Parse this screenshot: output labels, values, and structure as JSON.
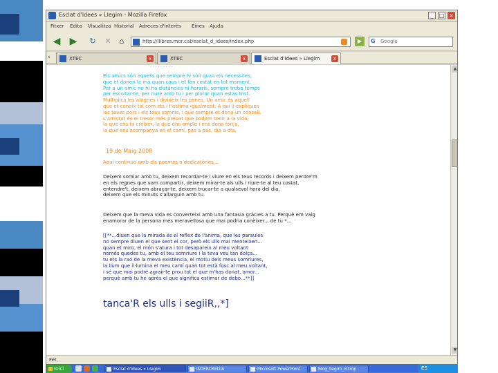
{
  "window": {
    "title": "Esclat d'Idees » Llegim - Mozilla Firefox",
    "buttons": {
      "minimize": "_",
      "maximize": "□",
      "close": "x"
    }
  },
  "menu": [
    "Fitxer",
    "Edita",
    "Visualitza",
    "Historial",
    "Adreces d'interès",
    "Eines",
    "Ajuda"
  ],
  "nav": {
    "url": "http://llibres.mor.cat/esclat_d_idees/index.php",
    "search_engine_glyph": "G",
    "search_placeholder": "Google"
  },
  "tabs": [
    {
      "label": "XTEC",
      "active": false
    },
    {
      "label": "XTEC",
      "active": false
    },
    {
      "label": "Esclat d'Idees » Llegim",
      "active": true
    }
  ],
  "content": {
    "top_fragment": "· · · · · · · · ·",
    "cyan_lines": [
      "Els amics són aquells que sempre hi són quan els necessites,",
      "que et donen la mà quan caus i et fan costat en tot moment.",
      "Per a un amic no hi ha distàncies ni horaris, sempre troba temps",
      "per escoltar-te, per riure amb tu i per plorar quan estàs trist.",
      "Multiplica les alegries i divideix les penes. Un amic és aquell",
      "que et coneix tal com ets i t'estima igualment. A qui li expliques",
      "les teves pors i els teus somnis, i que sempre et dona un consell.",
      "L'amistat és el tresor més preuat que podem tenir a la vida,"
    ],
    "orange_lines": [
      "la que ens fa créixer, la que ens omple i ens dona força,",
      "la que ens acompanya en el camí, pas a pas, dia a dia."
    ],
    "date": "19 de Maig 2008",
    "subtitle": "Aquí continuo amb els poemes o dedicatòries...",
    "dark_para1": [
      "Deixem somiar amb tu, deixem recordar-te i viure en els teus records i deixem perdre'm",
      "en els regnes que vam compartir, deixem mirar-te als ulls i riure-te al teu costat,",
      "entendre't, deixem abraçar-te, deixem trucar-te a qualsevol hora del dia,",
      "deixem que els minuts s'allarguin amb tu."
    ],
    "dark_para2": [
      "Deixem que la meva vida es converteixi amb una fantasia gràcies a tu. Perquè em vaig",
      "enamorar de la persona més meravellosa que mai podria conèixer... de tu *..."
    ],
    "navy_lines": [
      "[[**...diuen que la mirada és el reflex de l'ànima, que les paraules",
      "no sempre diuen el que sent el cor, però els ulls mai menteixen...",
      "quan et miro, el món s'atura i tot desapareix al meu voltant",
      "només quedes tu, amb el teu somriure i la teva veu tan dolça...",
      "tu ets la raó de la meva existència, el motiu dels meus somriures,",
      "la llum que il·lumina el meu camí quan tot està fosc al meu voltant,",
      "i sé que mai podré agrair-te prou tot el que m'has donat, amor...",
      "perquè amb tu he après el que significa estimar de debò...**]]"
    ],
    "closing": "tanca'R els ulls i segiiR,,*]"
  },
  "status": {
    "text": "Fet"
  },
  "taskbar": {
    "start_label": "Inici",
    "tasks": [
      {
        "label": "Esclat d'Idees » Llegim",
        "active": true
      },
      {
        "label": "INTERCREDIA",
        "active": false
      },
      {
        "label": "Microsoft PowerPoint",
        "active": false
      },
      {
        "label": "blog_llegim_d.tmp",
        "active": false
      }
    ],
    "tray_label": "ES"
  },
  "colors": {
    "cyan_text": "#1ab8d8",
    "orange_text": "#f08a1e",
    "navy_text": "#1a2a88",
    "taskbar": "#3a6ad8"
  }
}
